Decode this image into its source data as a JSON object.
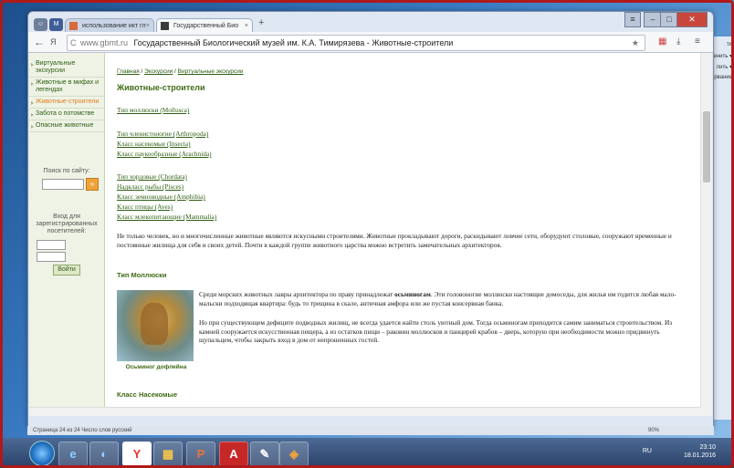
{
  "browser": {
    "tabs": [
      {
        "label": "использование икт гл",
        "active": false
      },
      {
        "label": "Государственный Био",
        "active": true
      }
    ],
    "new_tab": "+",
    "url": "www.gbmt.ru",
    "page_title": "Государственный Биологический музей им. К.А. Тимирязева - Животные-строители",
    "back_icon": "arrow-left-icon",
    "forward_icon": "arrow-right-icon",
    "reload_icon": "reload-icon"
  },
  "sidebar": {
    "items": [
      {
        "label": "Виртуальные экскурсии",
        "active": false
      },
      {
        "label": "Животные в мифах и легендах",
        "active": false
      },
      {
        "label": "Животные-строители",
        "active": true
      },
      {
        "label": "Забота о потомстве",
        "active": false
      },
      {
        "label": "Опасные животные",
        "active": false
      }
    ],
    "search_label": "Поиск по сайту:",
    "search_go": "»",
    "login_label": "Вход для зарегистрированных посетителей:",
    "login_button": "Войти"
  },
  "main": {
    "breadcrumbs": [
      "Главная",
      "Экскурсии",
      "Виртуальные экскурсии"
    ],
    "breadcrumb_sep": " / ",
    "title": "Животные-строители",
    "links": [
      "Тип моллюски (Mollusca)",
      "Тип членистоногие (Arthropoda)",
      "Класс насекомые (Insecta)",
      "Класс паукообразные (Arachnida)",
      "Тип хордовые (Chordata)",
      "Надкласс рыбы (Pisces)",
      "Класс земноводные (Amphibia)",
      "Класс птицы (Aves)",
      "Класс млекопитающие (Mammalia)"
    ],
    "intro": "Не только человек, но и многочисленные животные являются искусными строителями. Животные прокладывают дороги, раскидывают ловчие сети, оборудуют столовые, сооружают временные и постоянные жилища для себя и своих детей. Почти в каждой группе животного царства можно встретить замечательных архитекторов.",
    "section1": "Тип Моллюски",
    "para1_a": "Среди морских животных лавры архитектора по праву принадлежат ",
    "para1_b": "осьминогам",
    "para1_c": ". Эти головоногие моллюски настоящие домоседы, для жилья им годится любая мало-мальски подходящая квартира: будь то трещина в скале, античная амфора или же пустая консервная банка.",
    "para2": "Но при существующем дефиците подводных жилищ, не всегда удается найти столь уютный дом. Тогда осьминогам приходится самим заниматься строительством. Из камней сооружается искусственная пещера, а из остатков пищи – раковин моллюсков и панцирей крабов – дверь, которую при необходимости можно придвинуть щупальцем, чтобы закрыть вход в дом от непрошенных гостей.",
    "photo_caption": "Осьминог дофлейна",
    "section2": "Класс Насекомые"
  },
  "status": {
    "left": "Страница 24 из 24   Число слов   русский",
    "zoom": "90%"
  },
  "office_ribbon": [
    "ти",
    "енить ▾",
    "лить ▾",
    "рвание"
  ],
  "taskbar": {
    "apps": [
      "e",
      "◐",
      "Y",
      "▦",
      "P",
      "A",
      "✎",
      "◈"
    ],
    "time": "23:10",
    "date": "18.01.2016",
    "lang": "RU"
  },
  "colors": {
    "frame": "#b0191a",
    "site_green": "#3f6a14",
    "active_orange": "#e07b1a"
  }
}
